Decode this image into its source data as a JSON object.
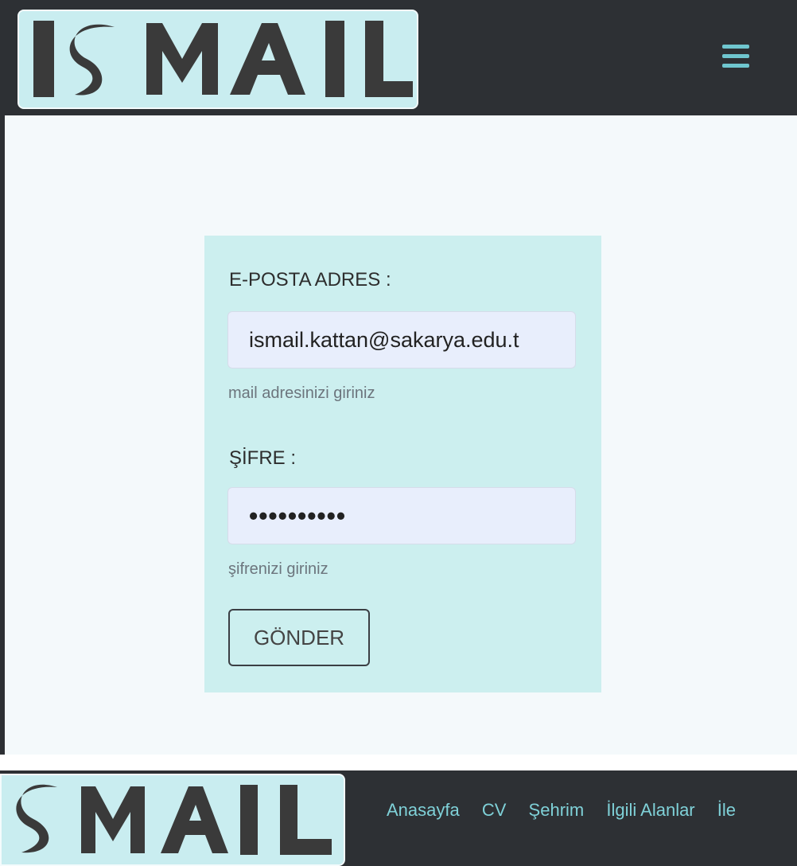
{
  "brand": {
    "logo_text": "ISMAIL"
  },
  "colors": {
    "navbar": "#2d3034",
    "accent": "#6fc6cf",
    "card": "#ccefef",
    "input_bg": "#e8eefc"
  },
  "top_nav": {
    "menu_icon": "hamburger-icon"
  },
  "form": {
    "email_label": "E-POSTA ADRES :",
    "email_value": "ismail.kattan@sakarya.edu.t",
    "email_hint": "mail adresinizi giriniz",
    "password_label": "ŞİFRE :",
    "password_value": "••••••••••",
    "password_hint": "şifrenizi giriniz",
    "submit_label": "GÖNDER"
  },
  "bottom_nav": {
    "links": [
      "Anasayfa",
      "CV",
      "Şehrim",
      "İlgili Alanlar",
      "İle"
    ]
  }
}
